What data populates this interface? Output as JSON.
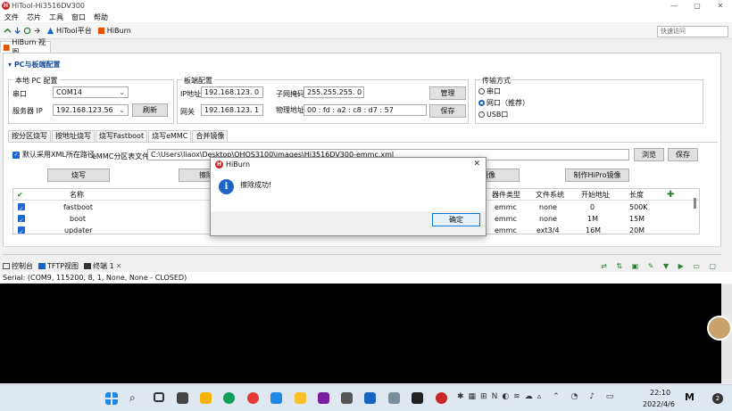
{
  "window": {
    "title": "HiTool-Hi3516DV300",
    "controls": [
      "—",
      "▢",
      "✕"
    ]
  },
  "menu": [
    "文件",
    "芯片",
    "工具",
    "窗口",
    "帮助"
  ],
  "toolbar": {
    "hitool_label": "HiTool平台",
    "hiburn_label": "HiBurn",
    "search_placeholder": "快速访问"
  },
  "view_tab": {
    "label": "HiBurn 视图"
  },
  "section": {
    "title": "PC与板端配置"
  },
  "local": {
    "title": "本地 PC 配置",
    "port_label": "串口",
    "port_value": "COM14",
    "server_label": "服务器 IP",
    "server_value": "192.168.123.56",
    "refresh": "刷新"
  },
  "board": {
    "title": "板端配置",
    "ip_label": "IP地址",
    "ip_value": "192.168.123. 0",
    "mask_label": "子网掩码",
    "mask_value": "255.255.255. 0",
    "gw_label": "网关",
    "gw_value": "192.168.123. 1",
    "mac_label": "物理地址",
    "mac_value": "00 : fd : a2 : c8 : d7 : 57",
    "manage": "管理",
    "save": "保存"
  },
  "transfer": {
    "title": "传输方式",
    "options": [
      "串口",
      "网口（推荐）",
      "USB口"
    ],
    "selected": 1
  },
  "tabs": [
    "按分区烧写",
    "按地址烧写",
    "烧写Fastboot",
    "烧写eMMC",
    "合并镜像"
  ],
  "active_tab": 3,
  "emmc": {
    "use_xml_label": "默认采用XML所在路径",
    "table_label": "eMMC分区表文件",
    "path": "C:\\Users\\liaox\\Desktop\\OHOS3100\\images\\Hi3516DV300-emmc.xml",
    "browse": "浏览",
    "save": "保存",
    "burn": "烧写",
    "erase": "擦除全",
    "image": "镜像",
    "make_hipro": "制作HiPro镜像"
  },
  "table": {
    "headers": {
      "name": "名称",
      "dev": "器件类型",
      "fs": "文件系统",
      "start": "开始地址",
      "len": "长度"
    },
    "rows": [
      {
        "name": "fastboot",
        "dev": "emmc",
        "fs": "none",
        "start": "0",
        "len": "500K"
      },
      {
        "name": "boot",
        "dev": "emmc",
        "fs": "none",
        "start": "1M",
        "len": "15M"
      },
      {
        "name": "updater",
        "dev": "emmc",
        "fs": "ext3/4",
        "start": "16M",
        "len": "20M"
      }
    ]
  },
  "dialog": {
    "title": "HiBurn",
    "message": "擦除成功!",
    "ok": "确定"
  },
  "console": {
    "tabs": [
      "控制台",
      "TFTP视图",
      "终端 1"
    ],
    "serial": "Serial: (COM9, 115200, 8, 1, None, None - CLOSED)"
  },
  "taskbar": {
    "time": "22:10",
    "date": "2022/4/6",
    "badge": "2"
  },
  "colors": {
    "accent": "#1a66d6",
    "header": "#1b4f9c",
    "brand": "#c62828"
  }
}
